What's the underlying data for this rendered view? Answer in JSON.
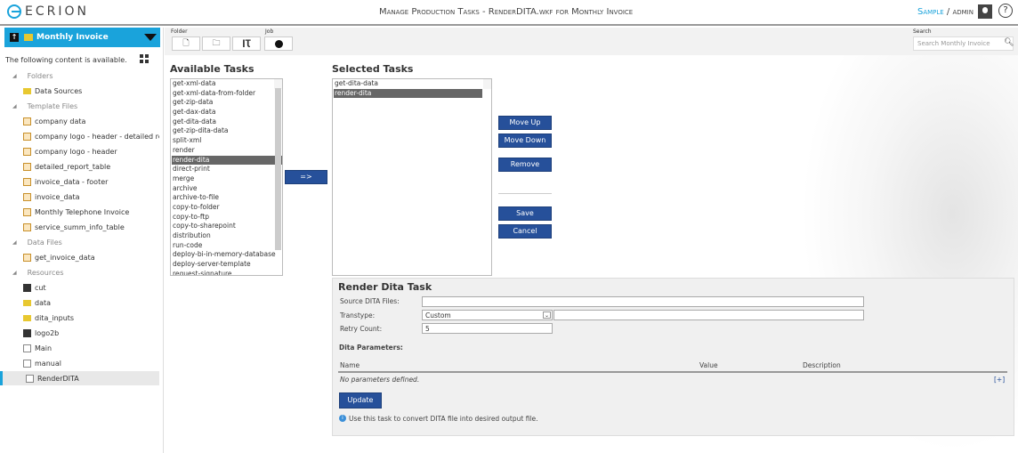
{
  "header": {
    "logo": "ECRION",
    "title": "Manage Production Tasks - RenderDITA.wkf for Monthly Invoice",
    "user_org": "Sample",
    "user_sep": " / ",
    "user_name": "admin",
    "help": "?"
  },
  "sidebar": {
    "selector": "Monthly Invoice",
    "intro": "The following content is available.",
    "rows": [
      {
        "type": "cat",
        "label": "Folders"
      },
      {
        "type": "item",
        "icon": "folder",
        "label": "Data Sources"
      },
      {
        "type": "cat",
        "label": "Template Files"
      },
      {
        "type": "item",
        "icon": "tmpl",
        "label": "company data"
      },
      {
        "type": "item",
        "icon": "tmpl",
        "label": "company logo - header - detailed rep..."
      },
      {
        "type": "item",
        "icon": "tmpl",
        "label": "company logo - header"
      },
      {
        "type": "item",
        "icon": "tmpl",
        "label": "detailed_report_table"
      },
      {
        "type": "item",
        "icon": "tmpl",
        "label": "invoice_data - footer"
      },
      {
        "type": "item",
        "icon": "tmpl",
        "label": "invoice_data"
      },
      {
        "type": "item",
        "icon": "tmpl",
        "label": "Monthly Telephone Invoice"
      },
      {
        "type": "item",
        "icon": "tmpl",
        "label": "service_summ_info_table"
      },
      {
        "type": "cat",
        "label": "Data Files"
      },
      {
        "type": "item",
        "icon": "tmpl",
        "label": "get_invoice_data"
      },
      {
        "type": "cat",
        "label": "Resources"
      },
      {
        "type": "item",
        "icon": "img",
        "label": "cut"
      },
      {
        "type": "item",
        "icon": "folder",
        "label": "data"
      },
      {
        "type": "item",
        "icon": "folder",
        "label": "dita_inputs"
      },
      {
        "type": "item",
        "icon": "img",
        "label": "logo2b"
      },
      {
        "type": "item",
        "icon": "file",
        "label": "Main"
      },
      {
        "type": "item",
        "icon": "file",
        "label": "manual"
      },
      {
        "type": "item",
        "icon": "file",
        "label": "RenderDITA",
        "selected": true
      }
    ]
  },
  "toolbar": {
    "folder_label": "Folder",
    "job_label": "Job",
    "search_label": "Search",
    "search_placeholder": "Search Monthly Invoice"
  },
  "available": {
    "title": "Available Tasks",
    "selected": "render-dita",
    "items": [
      "get-xml-data",
      "get-xml-data-from-folder",
      "get-zip-data",
      "get-dax-data",
      "get-dita-data",
      "get-zip-dita-data",
      "split-xml",
      "render",
      "render-dita",
      "direct-print",
      "merge",
      "archive",
      "archive-to-file",
      "copy-to-folder",
      "copy-to-ftp",
      "copy-to-sharepoint",
      "distribution",
      "run-code",
      "deploy-bi-in-memory-database",
      "deploy-server-template",
      "request-signature"
    ]
  },
  "add_button": "=>",
  "selected_tasks": {
    "title": "Selected Tasks",
    "selected": "render-dita",
    "items": [
      "get-dita-data",
      "render-dita"
    ]
  },
  "actions": {
    "move_up": "Move Up",
    "move_down": "Move Down",
    "remove": "Remove",
    "save": "Save",
    "cancel": "Cancel"
  },
  "panel": {
    "title": "Render Dita Task",
    "source_label": "Source DITA Files:",
    "source_value": "",
    "transtype_label": "Transtype:",
    "transtype_value": "Custom",
    "transtype_custom": "",
    "retry_label": "Retry Count:",
    "retry_value": "5",
    "params_title": "Dita Parameters:",
    "col_name": "Name",
    "col_value": "Value",
    "col_description": "Description",
    "empty": "No parameters defined.",
    "add": "[+]",
    "update": "Update",
    "info": "Use this task to convert DITA file into desired output file."
  },
  "colors": {
    "accent": "#1aa3db",
    "button": "#26509a"
  }
}
